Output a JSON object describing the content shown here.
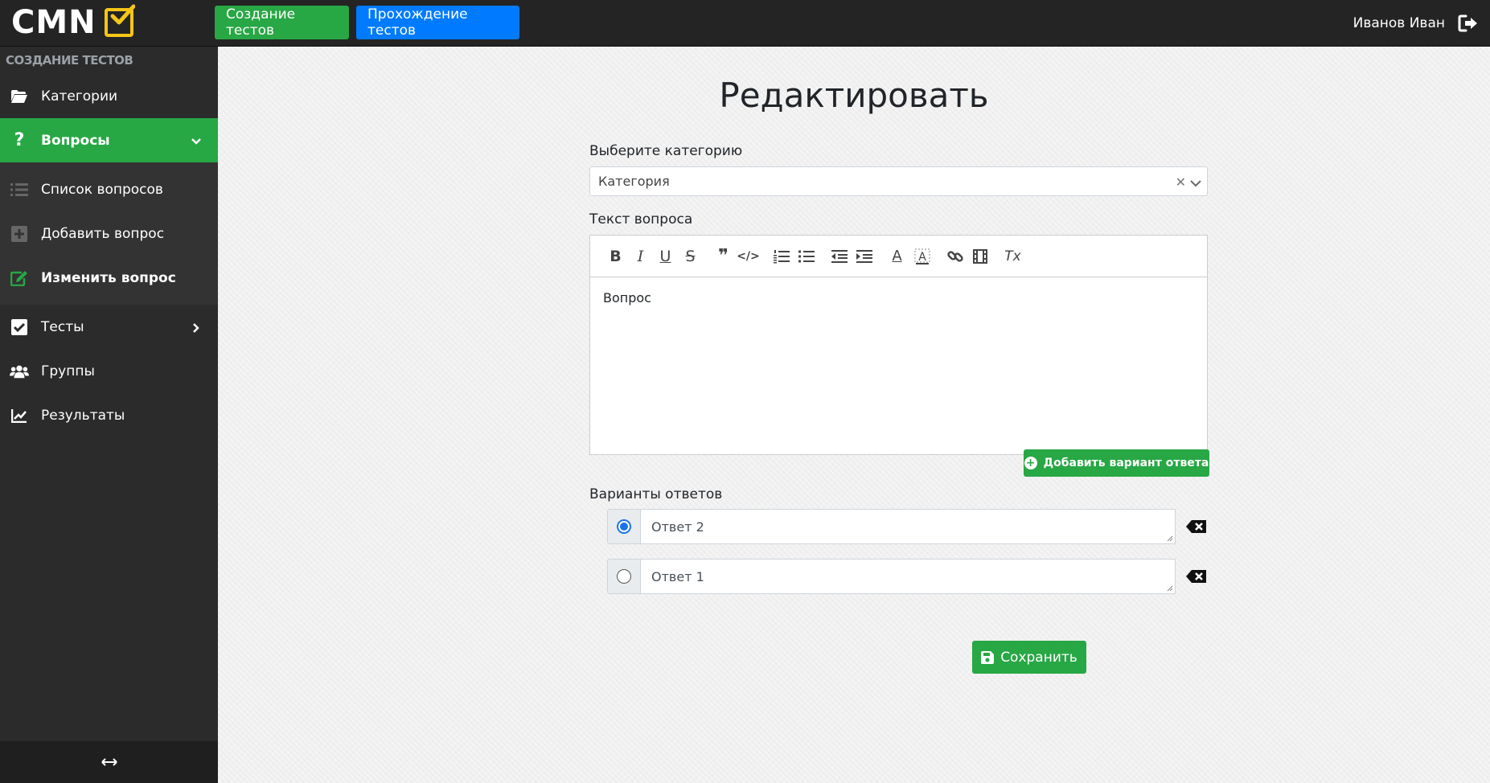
{
  "app": {
    "logo_text": "CMN",
    "user_name": "Иванов Иван"
  },
  "topnav": {
    "create_tests": "Создание тестов",
    "take_tests": "Прохождение тестов"
  },
  "sidebar": {
    "section_title": "Создание тестов",
    "categories": "Категории",
    "questions": "Вопросы",
    "question_list": "Список вопросов",
    "add_question": "Добавить вопрос",
    "edit_question": "Изменить вопрос",
    "tests": "Тесты",
    "groups": "Группы",
    "results": "Результаты"
  },
  "main": {
    "title": "Редактировать",
    "category_label": "Выберите категорию",
    "category_value": "Категория",
    "question_label": "Текст вопроса",
    "question_text": "Вопрос",
    "add_answer_button": "Добавить вариант ответа",
    "answers_label": "Варианты ответов",
    "answers": [
      {
        "text": "Ответ 2",
        "checked": true
      },
      {
        "text": "Ответ 1",
        "checked": false
      }
    ],
    "save_button": "Сохранить"
  },
  "toolbar": {
    "bold": "B",
    "italic": "I",
    "underline": "U",
    "strike": "S",
    "quote": "❞",
    "code": "</>",
    "text_color": "A",
    "clear": "Tx"
  },
  "colors": {
    "accent_green": "#28a745",
    "accent_blue": "#007bff",
    "sidebar_bg": "#2b2b2b",
    "logo_check": "#f5c518"
  }
}
